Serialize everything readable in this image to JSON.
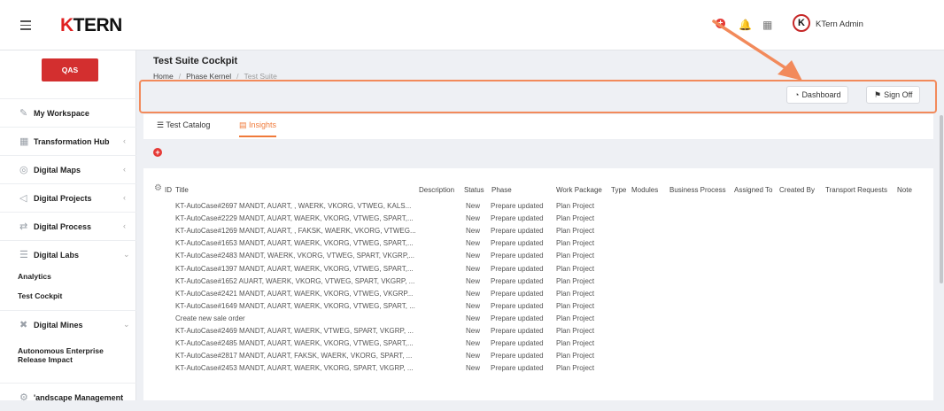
{
  "header": {
    "logo_k": "K",
    "logo_text": "TERN",
    "user_name": "KTern Admin",
    "avatar_letter": "K"
  },
  "sidebar": {
    "environment": "QAS",
    "items": [
      {
        "label": "My Workspace",
        "icon": "workspace-icon"
      },
      {
        "label": "Transformation Hub",
        "icon": "grid-icon"
      },
      {
        "label": "Digital Maps",
        "icon": "map-icon"
      },
      {
        "label": "Digital Projects",
        "icon": "send-icon"
      },
      {
        "label": "Digital Process",
        "icon": "process-icon"
      },
      {
        "label": "Digital Labs",
        "icon": "labs-icon"
      },
      {
        "label": "Digital Mines",
        "icon": "mines-icon"
      },
      {
        "label": "'andscape Management",
        "icon": "landscape-icon"
      }
    ],
    "labs_sub": [
      "Analytics",
      "Test Cockpit"
    ],
    "mines_sub": "Autonomous Enterprise Release Impact"
  },
  "page": {
    "title": "Test Suite Cockpit",
    "breadcrumb": [
      "Home",
      "Phase Kernel",
      "Test Suite"
    ],
    "dashboard_label": "Dashboard",
    "signoff_label": "Sign Off"
  },
  "tabs": {
    "catalog": "Test Catalog",
    "insights": "Insights"
  },
  "table": {
    "columns": [
      "ID",
      "Title",
      "Description",
      "Status",
      "Phase",
      "Work Package",
      "Type",
      "Modules",
      "Business Process",
      "Assigned To",
      "Created By",
      "Transport Requests",
      "Note"
    ],
    "rows": [
      {
        "title": "KT-AutoCase#2697 MANDT, AUART, , WAERK, VKORG, VTWEG, KALS...",
        "status": "New",
        "phase": "Prepare updated",
        "wp": "Plan Project"
      },
      {
        "title": "KT-AutoCase#2229 MANDT, AUART, WAERK, VKORG, VTWEG, SPART,...",
        "status": "New",
        "phase": "Prepare updated",
        "wp": "Plan Project"
      },
      {
        "title": "KT-AutoCase#1269 MANDT, AUART, , FAKSK, WAERK, VKORG, VTWEG...",
        "status": "New",
        "phase": "Prepare updated",
        "wp": "Plan Project"
      },
      {
        "title": "KT-AutoCase#1653 MANDT, AUART, WAERK, VKORG, VTWEG, SPART,...",
        "status": "New",
        "phase": "Prepare updated",
        "wp": "Plan Project"
      },
      {
        "title": "KT-AutoCase#2483 MANDT, WAERK, VKORG, VTWEG, SPART, VKGRP,...",
        "status": "New",
        "phase": "Prepare updated",
        "wp": "Plan Project"
      },
      {
        "title": "KT-AutoCase#1397 MANDT, AUART, WAERK, VKORG, VTWEG, SPART,...",
        "status": "New",
        "phase": "Prepare updated",
        "wp": "Plan Project"
      },
      {
        "title": "KT-AutoCase#1652 AUART, WAERK, VKORG, VTWEG, SPART, VKGRP, ...",
        "status": "New",
        "phase": "Prepare updated",
        "wp": "Plan Project"
      },
      {
        "title": "KT-AutoCase#2421 MANDT, AUART, WAERK, VKORG, VTWEG, VKGRP...",
        "status": "New",
        "phase": "Prepare updated",
        "wp": "Plan Project"
      },
      {
        "title": "KT-AutoCase#1649 MANDT, AUART, WAERK, VKORG, VTWEG, SPART, ...",
        "status": "New",
        "phase": "Prepare updated",
        "wp": "Plan Project"
      },
      {
        "title": "Create new sale order",
        "status": "New",
        "phase": "Prepare updated",
        "wp": "Plan Project"
      },
      {
        "title": "KT-AutoCase#2469 MANDT, AUART, WAERK, VTWEG, SPART, VKGRP, ...",
        "status": "New",
        "phase": "Prepare updated",
        "wp": "Plan Project"
      },
      {
        "title": "KT-AutoCase#2485 MANDT, AUART, WAERK, VKORG, VTWEG, SPART,...",
        "status": "New",
        "phase": "Prepare updated",
        "wp": "Plan Project"
      },
      {
        "title": "KT-AutoCase#2817 MANDT, AUART, FAKSK, WAERK, VKORG, SPART, ...",
        "status": "New",
        "phase": "Prepare updated",
        "wp": "Plan Project"
      },
      {
        "title": "KT-AutoCase#2453 MANDT, AUART, WAERK, VKORG, SPART, VKGRP, ...",
        "status": "New",
        "phase": "Prepare updated",
        "wp": "Plan Project"
      }
    ]
  },
  "colors": {
    "accent": "#f07a3a",
    "brand_red": "#d32f2f",
    "highlight": "#f28a5b"
  }
}
